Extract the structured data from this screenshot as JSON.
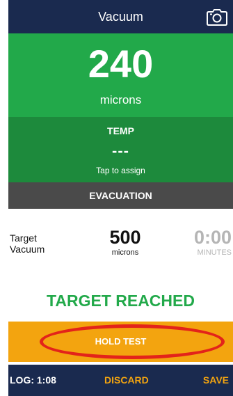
{
  "header": {
    "title": "Vacuum",
    "camera_icon": "camera-icon"
  },
  "reading": {
    "value": "240",
    "unit": "microns"
  },
  "temp": {
    "label": "TEMP",
    "value": "---",
    "hint": "Tap to assign"
  },
  "section": {
    "label": "EVACUATION"
  },
  "target": {
    "label_line1": "Target",
    "label_line2": "Vacuum",
    "value": "500",
    "unit": "microns",
    "timer_value": "0:00",
    "timer_unit": "MINUTES"
  },
  "status": {
    "text": "TARGET REACHED"
  },
  "hold_test": {
    "label": "HOLD TEST"
  },
  "footer": {
    "log": "LOG: 1:08",
    "discard": "DISCARD",
    "save": "SAVE"
  },
  "colors": {
    "header_bg": "#1a2a4f",
    "green": "#22a94a",
    "dark_green": "#1d8a3c",
    "gray": "#4a4a4a",
    "orange": "#f3a40f",
    "annotation_red": "#e3231a"
  }
}
